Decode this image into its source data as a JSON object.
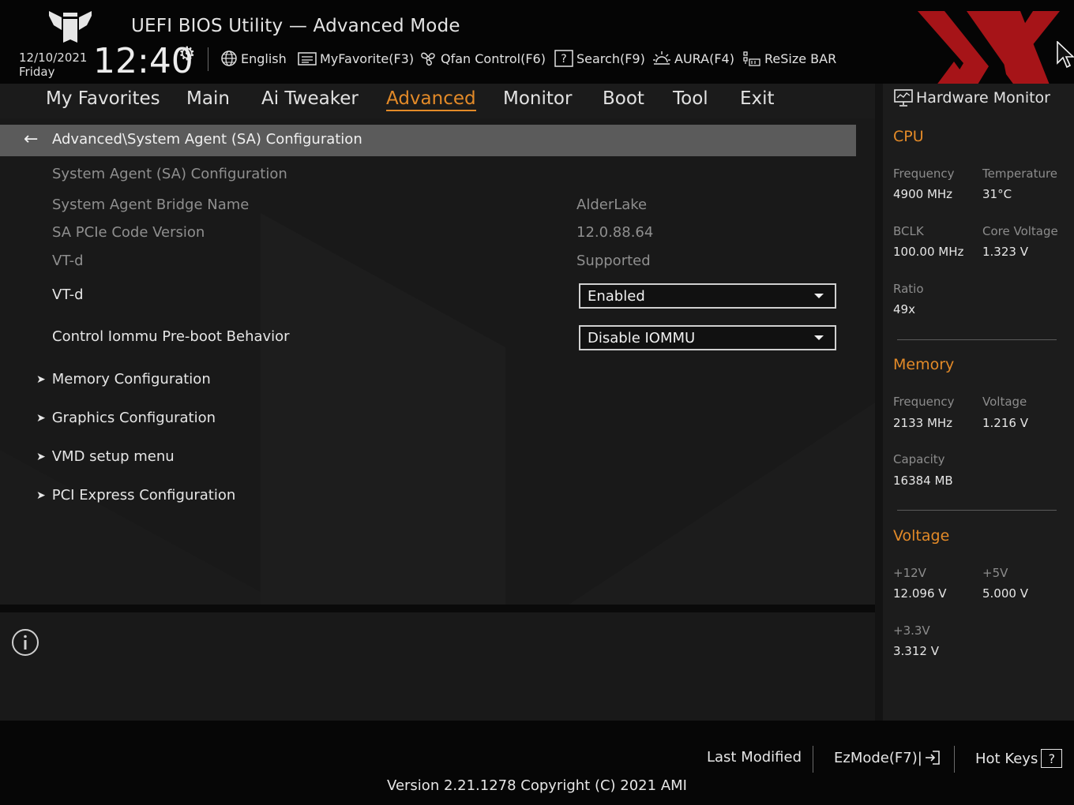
{
  "header": {
    "title": "UEFI BIOS Utility — Advanced Mode",
    "date": "12/10/2021",
    "weekday": "Friday",
    "time": "12:40",
    "tools": [
      {
        "label": "English",
        "icon": "globe-icon"
      },
      {
        "label": "MyFavorite(F3)",
        "icon": "favorite-list-icon"
      },
      {
        "label": "Qfan Control(F6)",
        "icon": "fan-icon"
      },
      {
        "label": "Search(F9)",
        "icon": "search-help-icon"
      },
      {
        "label": "AURA(F4)",
        "icon": "aura-light-icon"
      },
      {
        "label": "ReSize BAR",
        "icon": "resize-bar-icon"
      }
    ]
  },
  "nav": {
    "tabs": [
      {
        "label": "My Favorites"
      },
      {
        "label": "Main"
      },
      {
        "label": "Ai Tweaker"
      },
      {
        "label": "Advanced"
      },
      {
        "label": "Monitor"
      },
      {
        "label": "Boot"
      },
      {
        "label": "Tool"
      },
      {
        "label": "Exit"
      }
    ],
    "active": "Advanced"
  },
  "main": {
    "breadcrumb": "Advanced\\System Agent (SA) Configuration",
    "info_rows": [
      {
        "label": "System Agent (SA) Configuration",
        "value": ""
      },
      {
        "label": "System Agent Bridge Name",
        "value": "AlderLake"
      },
      {
        "label": "SA PCIe Code Version",
        "value": "12.0.88.64"
      },
      {
        "label": "VT-d",
        "value": "Supported"
      }
    ],
    "settings": [
      {
        "label": "VT-d",
        "value": "Enabled"
      },
      {
        "label": "Control Iommu Pre-boot Behavior",
        "value": "Disable IOMMU"
      }
    ],
    "submenus": [
      {
        "label": "Memory Configuration"
      },
      {
        "label": "Graphics Configuration"
      },
      {
        "label": "VMD setup menu"
      },
      {
        "label": "PCI Express Configuration"
      }
    ]
  },
  "hardware_monitor": {
    "title": "Hardware Monitor",
    "cpu": {
      "heading": "CPU",
      "frequency_label": "Frequency",
      "frequency": "4900 MHz",
      "temperature_label": "Temperature",
      "temperature": "31°C",
      "bclk_label": "BCLK",
      "bclk": "100.00 MHz",
      "core_voltage_label": "Core Voltage",
      "core_voltage": "1.323 V",
      "ratio_label": "Ratio",
      "ratio": "49x"
    },
    "memory": {
      "heading": "Memory",
      "frequency_label": "Frequency",
      "frequency": "2133 MHz",
      "voltage_label": "Voltage",
      "voltage": "1.216 V",
      "capacity_label": "Capacity",
      "capacity": "16384 MB"
    },
    "voltage": {
      "heading": "Voltage",
      "v12_label": "+12V",
      "v12": "12.096 V",
      "v5_label": "+5V",
      "v5": "5.000 V",
      "v33_label": "+3.3V",
      "v33": "3.312 V"
    }
  },
  "footer": {
    "last_modified": "Last Modified",
    "ezmode": "EzMode(F7)|",
    "hotkeys": "Hot Keys",
    "hotkeys_key": "?",
    "version": "Version 2.21.1278 Copyright (C) 2021 AMI"
  },
  "colors": {
    "accent": "#e38a28",
    "watermark": "#c0181c"
  }
}
